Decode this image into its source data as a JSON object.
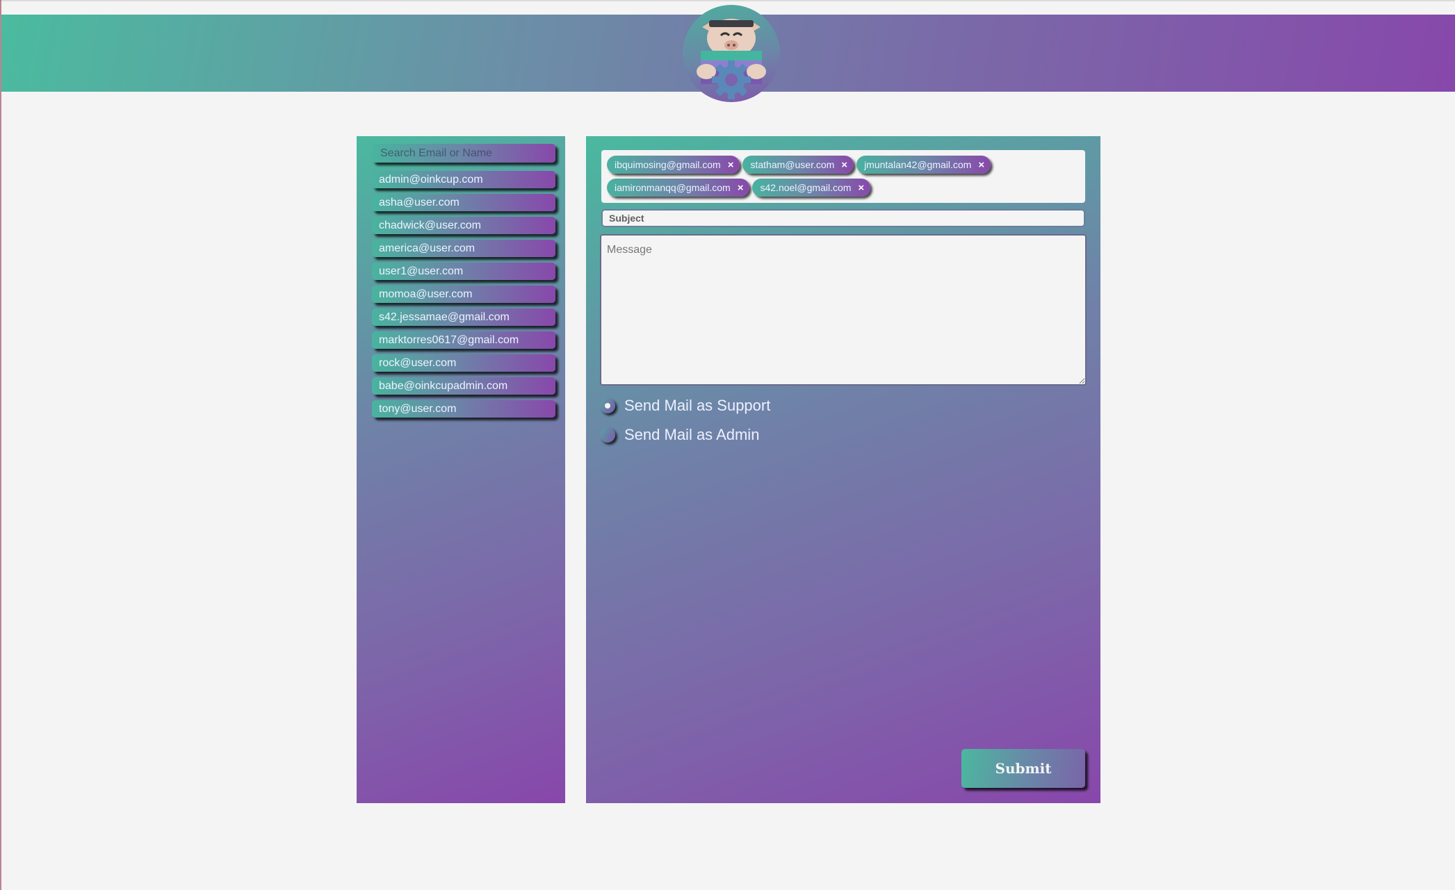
{
  "header": {
    "logo": "oinkcup-pig-mascot-logo"
  },
  "sidebar": {
    "search_placeholder": "Search Email or Name",
    "contacts": [
      "admin@oinkcup.com",
      "asha@user.com",
      "chadwick@user.com",
      "america@user.com",
      "user1@user.com",
      "momoa@user.com",
      "s42.jessamae@gmail.com",
      "marktorres0617@gmail.com",
      "rock@user.com",
      "babe@oinkcupadmin.com",
      "tony@user.com"
    ]
  },
  "compose": {
    "recipients": [
      "ibquimosing@gmail.com",
      "statham@user.com",
      "jmuntalan42@gmail.com",
      "iamironmanqq@gmail.com",
      "s42.noel@gmail.com"
    ],
    "remove_symbol": "×",
    "subject_placeholder": "Subject",
    "message_placeholder": "Message",
    "send_options": [
      {
        "label": "Send Mail as Support",
        "checked": true
      },
      {
        "label": "Send Mail as Admin",
        "checked": false
      }
    ],
    "submit_label": "Submit"
  },
  "colors": {
    "teal": "#4bbb9f",
    "purple": "#8748ab",
    "background": "#f4f4f4"
  }
}
